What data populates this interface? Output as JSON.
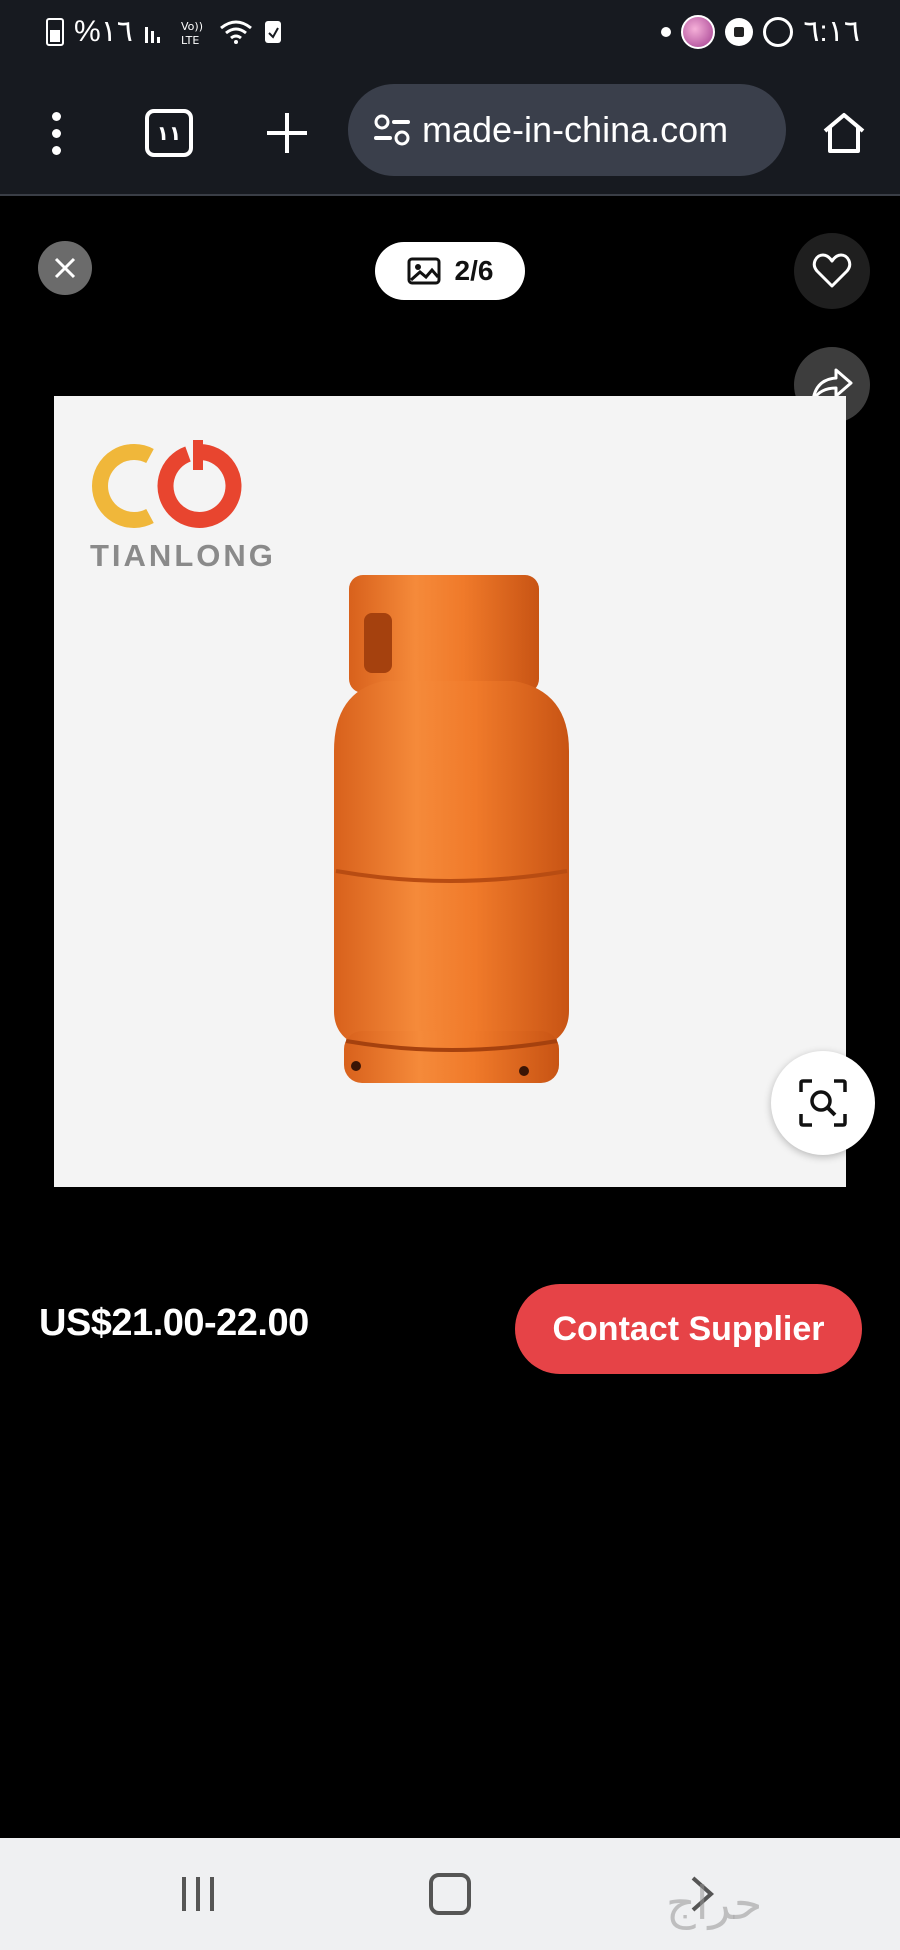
{
  "status_bar": {
    "battery_text": "%١٦",
    "time": "٦:١٦",
    "icons": [
      "battery-icon",
      "signal-icon",
      "volte-icon",
      "wifi-icon",
      "save-icon",
      "notification-dot",
      "avatar",
      "ball-icon",
      "whatsapp-icon"
    ]
  },
  "browser": {
    "tab_count": "١١",
    "url": "made-in-china.com"
  },
  "viewer": {
    "image_counter": "2/6"
  },
  "product": {
    "brand_text": "TIANLONG",
    "price": "US$21.00-22.00",
    "contact_label": "Contact Supplier"
  },
  "watermark": "حراج",
  "colors": {
    "accent": "#e64347",
    "cylinder": "#f07a2a",
    "logo_yellow": "#f0b73a",
    "logo_red": "#e8452f"
  }
}
